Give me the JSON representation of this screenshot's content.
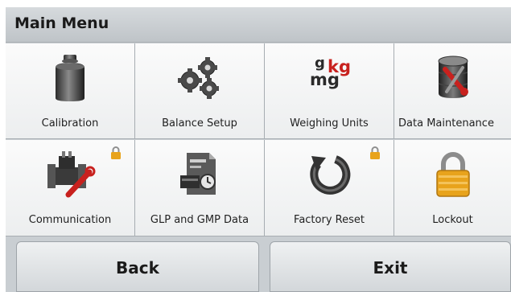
{
  "title_bar": {
    "title": "Main Menu"
  },
  "menu": {
    "items": [
      {
        "label": "Calibration",
        "icon": "calibration-weight-icon",
        "locked": false
      },
      {
        "label": "Balance Setup",
        "icon": "gears-icon",
        "locked": false
      },
      {
        "label": "Weighing Units",
        "icon": "units-icon",
        "locked": false,
        "icon_text": {
          "g": "g",
          "kg": "kg",
          "mg": "mg"
        }
      },
      {
        "label": "Data Maintenance",
        "icon": "database-tools-icon",
        "locked": false
      },
      {
        "label": "Communication",
        "icon": "communication-icon",
        "locked": true
      },
      {
        "label": "GLP and GMP Data",
        "icon": "glp-document-icon",
        "locked": false
      },
      {
        "label": "Factory Reset",
        "icon": "reset-arrow-icon",
        "locked": true
      },
      {
        "label": "Lockout",
        "icon": "padlock-icon",
        "locked": false
      }
    ]
  },
  "buttons": {
    "back": "Back",
    "exit": "Exit"
  },
  "colors": {
    "accent_red": "#c8211e",
    "lock_gold": "#e8a31c",
    "background": "#c9ced2"
  }
}
